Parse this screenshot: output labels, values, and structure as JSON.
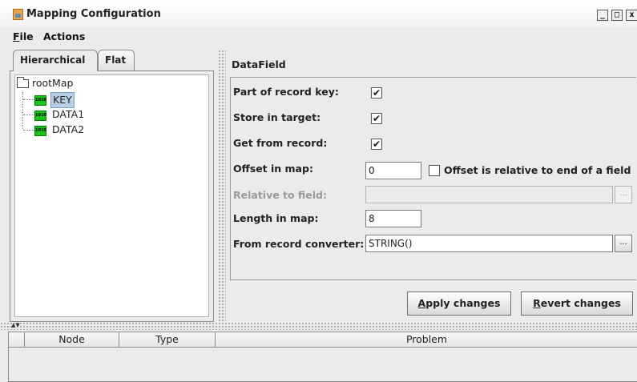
{
  "window": {
    "title": "Mapping Configuration",
    "minimize": "_",
    "maximize": "□",
    "close": "x"
  },
  "menu": {
    "file": {
      "mnemonic": "F",
      "rest": "ile"
    },
    "actions": "Actions"
  },
  "tabs": [
    "Hierarchical",
    "Flat"
  ],
  "tree": {
    "root": "rootMap",
    "items": [
      "KEY",
      "DATA1",
      "DATA2"
    ],
    "selected": "KEY",
    "leaf_icon_text": "1010"
  },
  "panel": {
    "title": "DataField",
    "part_of_key_label": "Part of record key:",
    "part_of_key_checked": "✔",
    "store_in_target_label": "Store in target:",
    "store_in_target_checked": "✔",
    "get_from_record_label": "Get from record:",
    "get_from_record_checked": "✔",
    "offset_label": "Offset in map:",
    "offset_value": "0",
    "offset_relative_label": "Offset is relative to end of a field",
    "relative_to_label": "Relative to field:",
    "relative_to_value": "",
    "length_label": "Length in map:",
    "length_value": "8",
    "converter_label": "From record converter:",
    "converter_value": "STRING()",
    "ellipsis": "..."
  },
  "buttons": {
    "apply": {
      "mnemonic": "A",
      "rest": "pply changes"
    },
    "revert": {
      "mnemonic": "R",
      "rest": "evert changes"
    }
  },
  "problems_table": {
    "columns": [
      "Node",
      "Type",
      "Problem"
    ]
  },
  "colors": {
    "background": "#ebebeb",
    "selection": "#b8cfe5",
    "leaf_icon": "#18c418"
  }
}
